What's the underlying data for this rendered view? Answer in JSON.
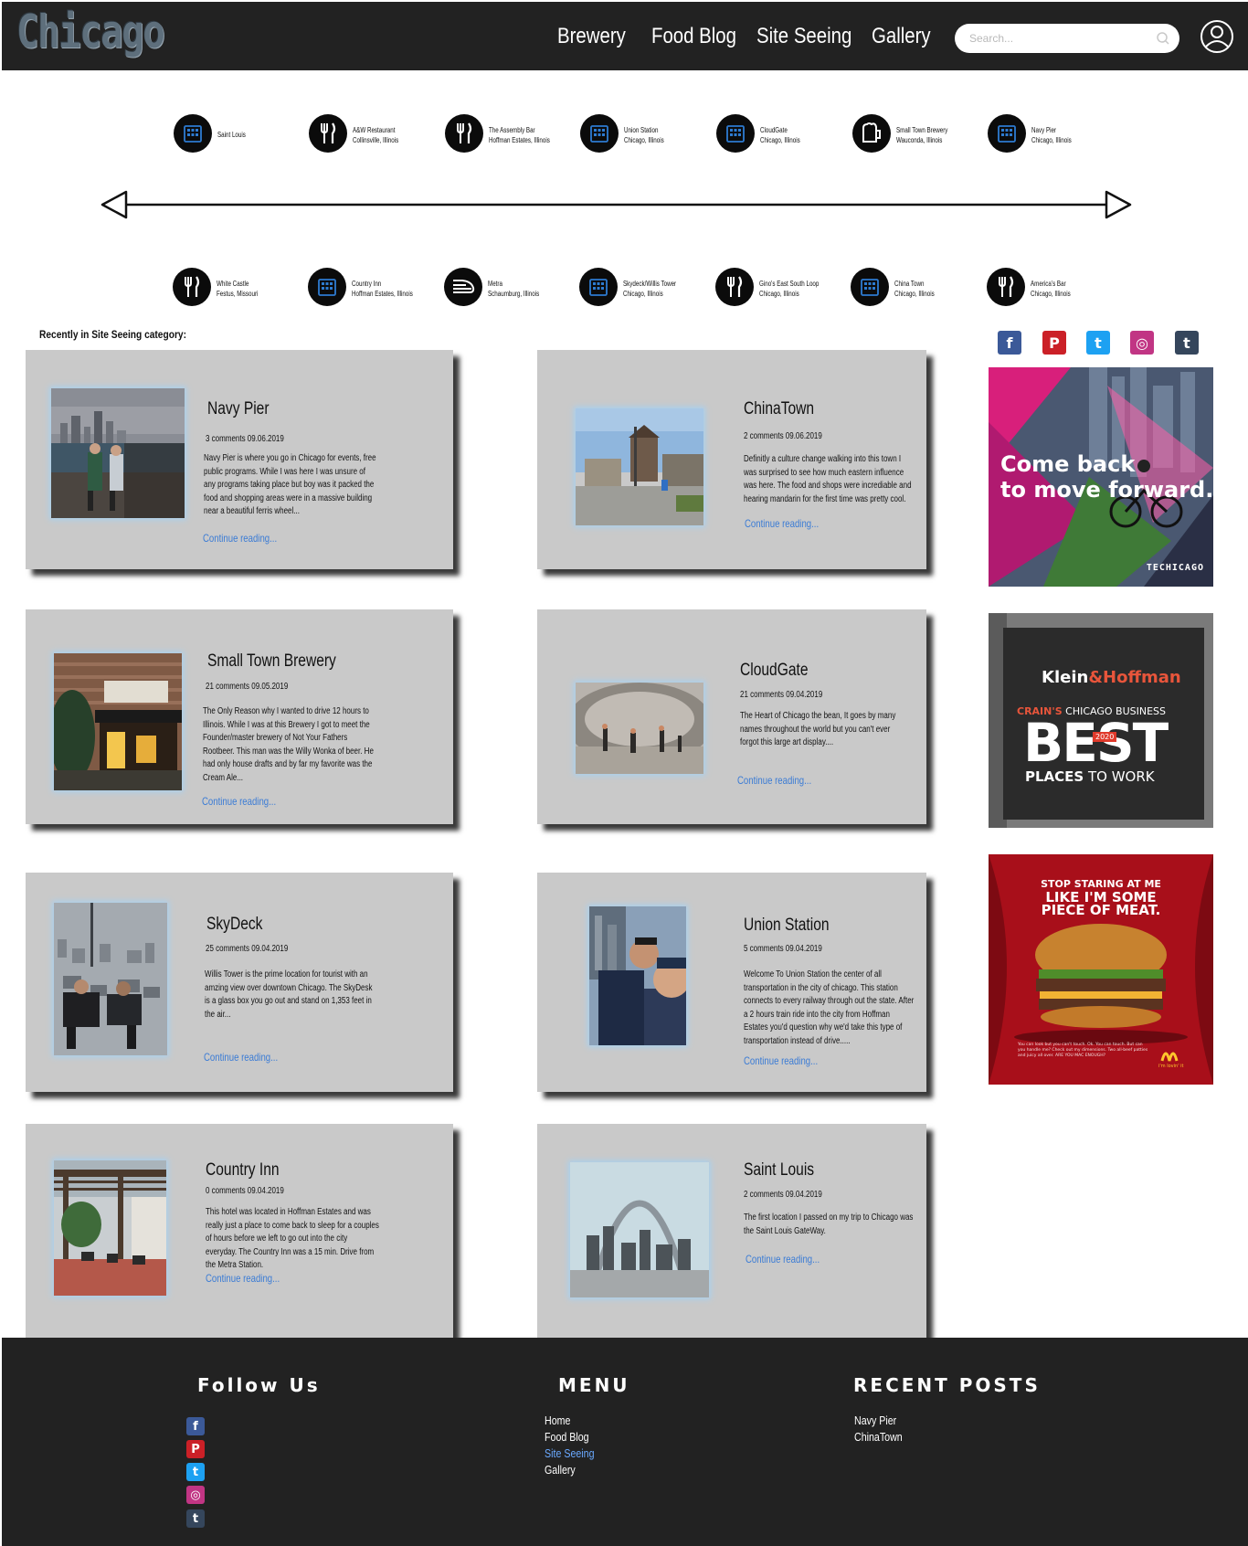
{
  "header": {
    "logo": "Chicago",
    "nav": [
      "Brewery",
      "Food Blog",
      "Site Seeing",
      "Gallery"
    ],
    "search_placeholder": "Search..."
  },
  "timeline": {
    "top": [
      {
        "icon": "building-icon",
        "line1": "Saint Louis",
        "line2": ""
      },
      {
        "icon": "fork-knife-icon",
        "line1": "A&W Restaurant",
        "line2": "Collinsville, Illinois"
      },
      {
        "icon": "fork-knife-icon",
        "line1": "The Assembly Bar",
        "line2": "Hoffman Estates, Illinois"
      },
      {
        "icon": "building-icon",
        "line1": "Union Station",
        "line2": "Chicago, Illinois"
      },
      {
        "icon": "building-icon",
        "line1": "CloudGate",
        "line2": "Chicago, Illinois"
      },
      {
        "icon": "beer-mug-icon",
        "line1": "Small Town Brewery",
        "line2": "Wauconda, Illinois"
      },
      {
        "icon": "building-icon",
        "line1": "Navy Pier",
        "line2": "Chicago, Illinois"
      }
    ],
    "bottom": [
      {
        "icon": "fork-knife-icon",
        "line1": "White Castle",
        "line2": "Festus, Missouri"
      },
      {
        "icon": "building-icon",
        "line1": "Country Inn",
        "line2": "Hoffman Estates, Illinois"
      },
      {
        "icon": "train-icon",
        "line1": "Metra",
        "line2": "Schaumburg, Illinois"
      },
      {
        "icon": "building-icon",
        "line1": "Skydeck/Willis Tower",
        "line2": "Chicago, Illinois"
      },
      {
        "icon": "fork-knife-icon",
        "line1": "Gino's East South Loop",
        "line2": "Chicago, Illinois"
      },
      {
        "icon": "building-icon",
        "line1": "China Town",
        "line2": "Chicago, Illinois"
      },
      {
        "icon": "fork-knife-icon",
        "line1": "America's Bar",
        "line2": "Chicago, Illinois"
      }
    ]
  },
  "section_title": "Recently in Site Seeing category:",
  "posts": [
    {
      "title": "Navy Pier",
      "meta": "3 comments  09.06.2019",
      "excerpt": "Navy Pier is where you go in Chicago for events, free public programs. While I was here I was unsure of any programs taking place but boy was it packed the food and shopping areas were in a massive building near a  beautiful ferris wheel...",
      "link": "Continue reading..."
    },
    {
      "title": "ChinaTown",
      "meta": "2 comments  09.06.2019",
      "excerpt": "Definitly a culture change walking into this town I was surprised to see how much eastern influence was here. The food and shops were incrediable and hearing mandarin for the first time was pretty cool.",
      "link": "Continue reading..."
    },
    {
      "title": "Small Town Brewery",
      "meta": "21 comments  09.05.2019",
      "excerpt": " The Only Reason why I wanted to drive 12 hours to Illinois. While I was at this Brewery I got to meet the Founder/master brewery of Not Your Fathers Rootbeer. This man was the Willy Wonka of beer. He had only house drafts and by far my favorite was the Cream Ale...",
      "link": "Continue reading..."
    },
    {
      "title": "CloudGate",
      "meta": "21 comments  09.04.2019",
      "excerpt": "The Heart of Chicago the bean, It goes by many names throughout the world but you can't ever forgot this large art display....",
      "link": "Continue reading..."
    },
    {
      "title": "SkyDeck",
      "meta": "25 comments  09.04.2019",
      "excerpt": "Willis Tower is the prime location for tourist with an amzing view over downtown Chicago. The SkyDesk is a glass box you go out and stand on 1,353 feet in the air...",
      "link": "Continue reading..."
    },
    {
      "title": "Union Station",
      "meta": "5 comments  09.04.2019",
      "excerpt": "Welcome To Union Station the center of all transportation in the city of chicago. This station connects to every railway through out the state. After a 2 hours train ride into the city from Hoffman Estates you'd question why we'd take this type of transportation instead of drive.....",
      "link": "Continue reading..."
    },
    {
      "title": "Country Inn",
      "meta": "0 comments  09.04.2019",
      "excerpt": "This hotel was located in Hoffman Estates and was really just a place to come back to sleep for a couples of hours before we left to go out into the city everyday. The Country Inn was a 15 min. Drive from the Metra Station.",
      "link": "Continue reading..."
    },
    {
      "title": "Saint Louis",
      "meta": "2 comments  09.04.2019",
      "excerpt": "The first location I passed on my trip to Chicago was the Saint Louis GateWay.",
      "link": "Continue reading..."
    }
  ],
  "sidebar": {
    "social": [
      {
        "icon": "facebook-icon",
        "glyph": "f",
        "color": "#3b5998"
      },
      {
        "icon": "pinterest-icon",
        "glyph": "P",
        "color": "#cb2027"
      },
      {
        "icon": "twitter-icon",
        "glyph": "t",
        "color": "#1da1f2"
      },
      {
        "icon": "instagram-icon",
        "glyph": "◎",
        "color": "#c13584"
      },
      {
        "icon": "tumblr-icon",
        "glyph": "t",
        "color": "#35465c"
      }
    ],
    "ad1": {
      "headline_1": "Come back",
      "headline_2": "to move forward.",
      "brand": "TECHICAGO"
    },
    "ad2": {
      "brand_a": "Klein",
      "brand_amp": "&",
      "brand_b": "Hoffman",
      "sub_a": "CRAIN'S",
      "sub_b": " CHICAGO BUSINESS",
      "big": "BEST",
      "year": "2020",
      "bottom_a": "PLACES",
      "bottom_b": " TO WORK"
    },
    "ad3": {
      "line1": "STOP STARING AT ME",
      "line2": "LIKE I'M SOME",
      "line3": "PIECE OF MEAT.",
      "small": "You can look but you can't touch. Ok. You can touch. But can you handle me? Check out my dimensions. Two all-beef patties and juicy all over. ARE YOU MAC ENOUGH?",
      "tagline": "i'm lovin' it"
    }
  },
  "footer": {
    "follow_title": "Follow Us",
    "menu_title": "MENU",
    "menu": [
      "Home",
      "Food Blog",
      "Site Seeing",
      "Gallery"
    ],
    "recent_title": "RECENT POSTS",
    "recent": [
      "Navy Pier",
      "ChinaTown"
    ]
  },
  "colors": {
    "header_bg": "#222222",
    "card_bg": "#c9c9c9",
    "link": "#3a7bd5",
    "active_menu": "#6aa9ff"
  }
}
